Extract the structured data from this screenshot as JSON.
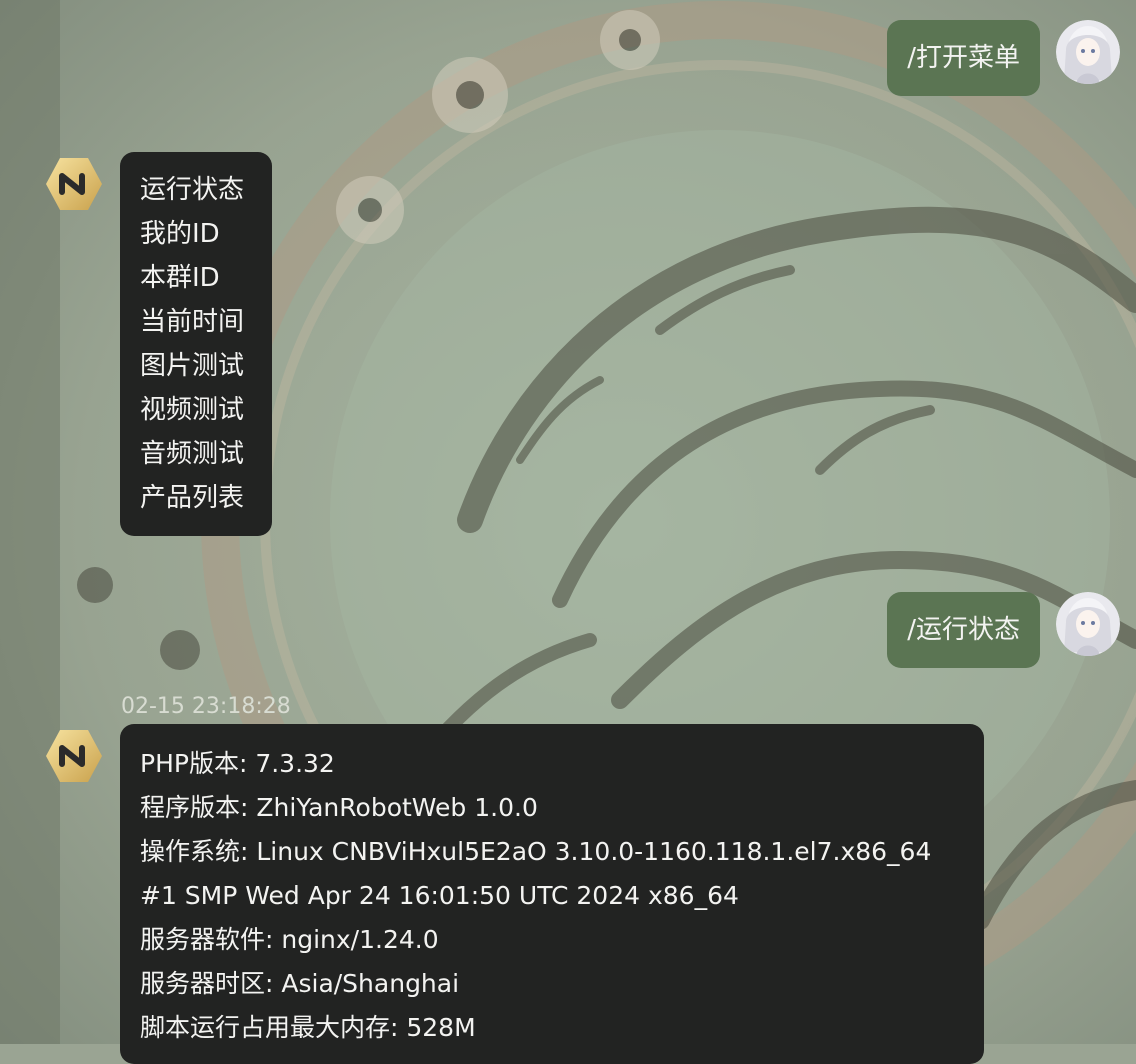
{
  "messages": [
    {
      "sender": "user",
      "text": "/打开菜单"
    },
    {
      "sender": "bot",
      "menu_items": [
        "运行状态",
        "我的ID",
        "本群ID",
        "当前时间",
        "图片测试",
        "视频测试",
        "音频测试",
        "产品列表"
      ]
    },
    {
      "sender": "user",
      "text": "/运行状态"
    },
    {
      "sender": "bot",
      "timestamp": "02-15 23:18:28",
      "lines": [
        "PHP版本: 7.3.32",
        "程序版本: ZhiYanRobotWeb 1.0.0",
        "操作系统: Linux CNBViHxul5E2aO 3.10.0-1160.118.1.el7.x86_64",
        "#1 SMP Wed Apr 24 16:01:50 UTC 2024 x86_64",
        "服务器软件: nginx/1.24.0",
        "服务器时区: Asia/Shanghai",
        "脚本运行占用最大内存: 528M"
      ]
    }
  ],
  "icons": {
    "bot_avatar": "bot-logo-icon",
    "user_avatar": "user-avatar-icon"
  },
  "colors": {
    "user_bubble": "#5b7553",
    "bot_bubble": "#222322",
    "background": "#9aa493"
  }
}
